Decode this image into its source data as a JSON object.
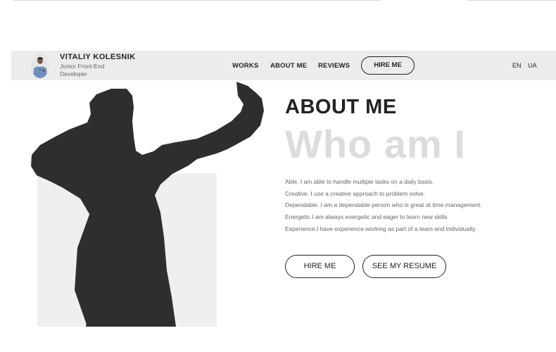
{
  "header": {
    "name": "VITALIY KOLESNIK",
    "role": "Junior Front-End Developer",
    "avatar_icon": "developer-avatar",
    "nav": {
      "works": "WORKS",
      "about": "ABOUT ME",
      "reviews": "REVIEWS",
      "hire": "HIRE ME"
    },
    "languages": [
      "EN",
      "UA"
    ],
    "background_color": "#ececec"
  },
  "hero": {
    "title": "ABOUT ME",
    "subtitle": "Who am I",
    "subtitle_color": "#dcdcdc",
    "description": [
      "Able. I am able to handle multiple tasks on a daily basis.",
      "Creative. I use a creative approach to problem solve.",
      "Dependable. I am a dependable person who is great at time management.",
      "Energetic.I am always energetic and eager to learn new skills",
      "Experience.I have experience working as part of a team and individually."
    ],
    "buttons": {
      "hire": "HIRE ME",
      "resume": "SEE MY RESUME"
    },
    "silhouette_color": "#2e2e2e"
  }
}
